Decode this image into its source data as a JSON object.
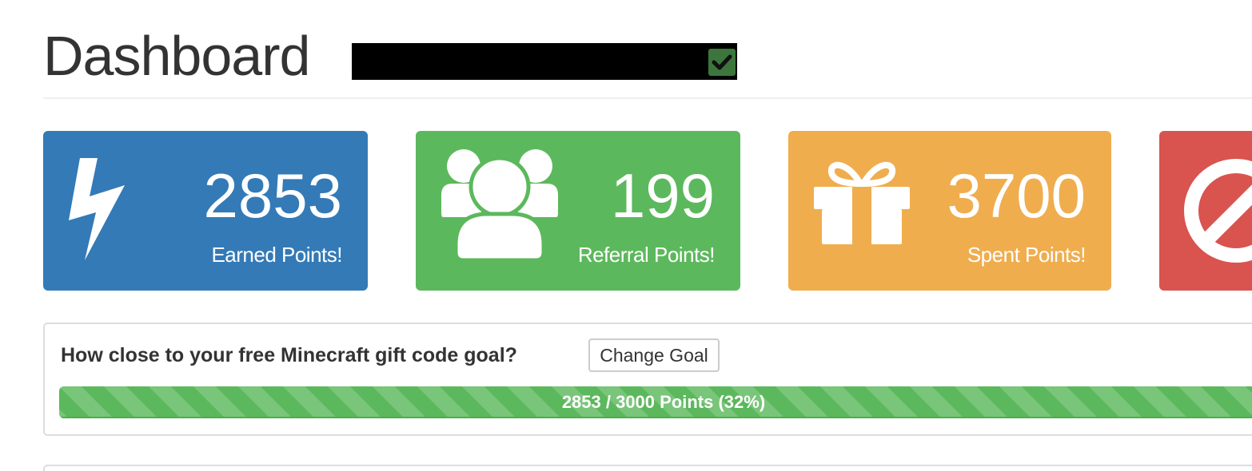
{
  "header": {
    "title": "Dashboard",
    "verified_icon": "check-square-icon",
    "verified_color": "#3c763d"
  },
  "stats": [
    {
      "value": "2853",
      "label": "Earned Points!",
      "icon": "bolt-icon",
      "color": "#337ab7"
    },
    {
      "value": "199",
      "label": "Referral Points!",
      "icon": "users-icon",
      "color": "#5cb85c"
    },
    {
      "value": "3700",
      "label": "Spent Points!",
      "icon": "gift-icon",
      "color": "#f0ad4e"
    },
    {
      "value": "",
      "label": "",
      "icon": "ban-icon",
      "color": "#d9534f"
    }
  ],
  "goal": {
    "question": "How close to your free Minecraft gift code goal?",
    "change_button": "Change Goal",
    "progress_text": "2853 / 3000 Points (32%)",
    "progress_percent": 100,
    "progress_color": "#5cb85c"
  }
}
